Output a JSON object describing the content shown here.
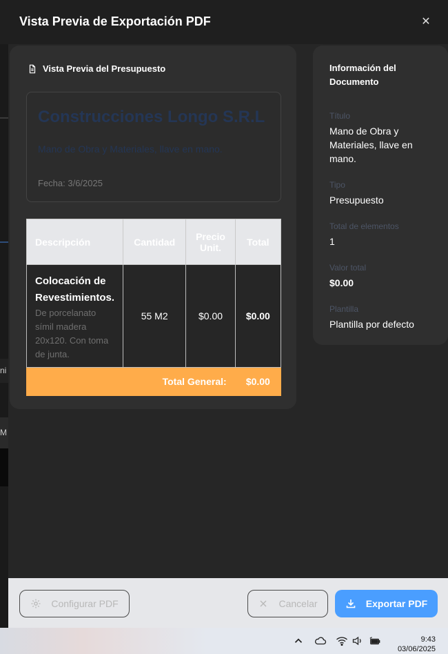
{
  "background_app": {
    "fragment_1": "ni",
    "fragment_2": "M"
  },
  "modal": {
    "title": "Vista Previa de Exportación PDF",
    "close_icon": "close-icon"
  },
  "preview": {
    "title": "Vista Previa del Presupuesto",
    "document": {
      "company": "Construcciones Longo S.R.L",
      "subtitle": "Mano de Obra y Materiales, llave en mano.",
      "date": "Fecha: 3/6/2025"
    },
    "table": {
      "headers": [
        "Descripción",
        "Cantidad",
        "Precio Unit.",
        "Total"
      ],
      "rows": [
        {
          "title": "Colocación de Revestimientos.",
          "description": "De porcelanato símil madera 20x120. Con toma de junta.",
          "quantity": "55 M2",
          "unit_price": "$0.00",
          "total": "$0.00"
        }
      ],
      "total_label": "Total General:",
      "total_value": "$0.00"
    }
  },
  "info": {
    "title": "Información del Documento",
    "fields": [
      {
        "label": "Título",
        "value": "Mano de Obra y Materiales, llave en mano."
      },
      {
        "label": "Tipo",
        "value": "Presupuesto"
      },
      {
        "label": "Total de elementos",
        "value": "1"
      },
      {
        "label": "Valor total",
        "value": "$0.00"
      },
      {
        "label": "Plantilla",
        "value": "Plantilla por defecto"
      }
    ]
  },
  "footer": {
    "configure_label": "Configurar PDF",
    "cancel_label": "Cancelar",
    "export_label": "Exportar PDF"
  },
  "taskbar": {
    "time": "9:43",
    "date": "03/06/2025"
  },
  "colors": {
    "accent": "#4a9eff",
    "total_row": "#ffac4a",
    "company_text": "#243655"
  }
}
